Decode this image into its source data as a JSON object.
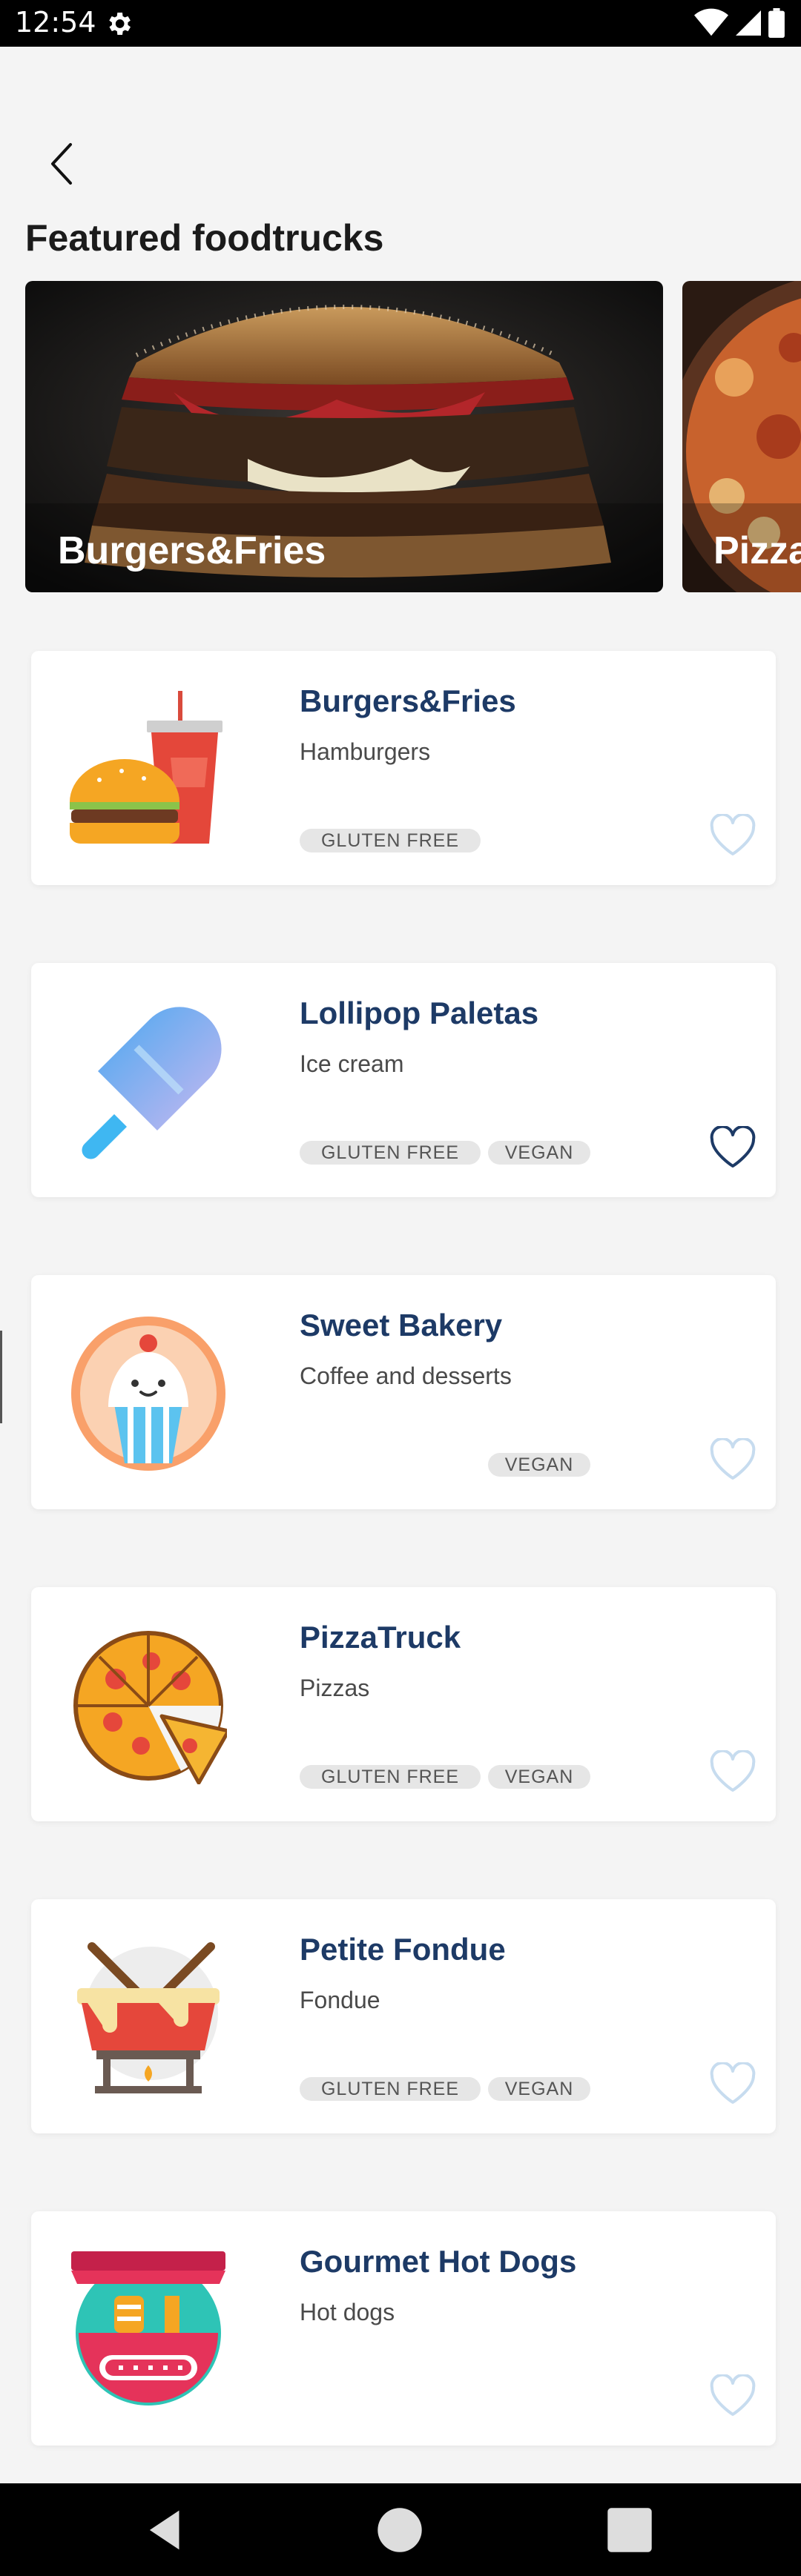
{
  "status_bar": {
    "time": "12:54",
    "icons": [
      "gear-icon",
      "wifi-icon",
      "signal-icon",
      "battery-icon"
    ]
  },
  "header": {
    "back_icon": "chevron-left-icon",
    "title": "Featured foodtrucks"
  },
  "featured": [
    {
      "label": "Burgers&Fries",
      "image": "burger-photo"
    },
    {
      "label": "Pizza",
      "image": "pizza-photo"
    }
  ],
  "trucks": [
    {
      "name": "Burgers&Fries",
      "type": "Hamburgers",
      "icon": "burger-soda-icon",
      "tags": {
        "gluten": "GLUTEN FREE"
      },
      "favorite": false
    },
    {
      "name": "Lollipop Paletas",
      "type": "Ice cream",
      "icon": "popsicle-icon",
      "tags": {
        "gluten": "GLUTEN FREE",
        "vegan": "VEGAN"
      },
      "favorite": true
    },
    {
      "name": "Sweet Bakery",
      "type": "Coffee and desserts",
      "icon": "cupcake-icon",
      "tags": {
        "vegan": "VEGAN"
      },
      "favorite": false
    },
    {
      "name": "PizzaTruck",
      "type": "Pizzas",
      "icon": "pizza-icon",
      "tags": {
        "gluten": "GLUTEN FREE",
        "vegan": "VEGAN"
      },
      "favorite": false
    },
    {
      "name": "Petite Fondue",
      "type": "Fondue",
      "icon": "fondue-icon",
      "tags": {
        "gluten": "GLUTEN FREE",
        "vegan": "VEGAN"
      },
      "favorite": false
    },
    {
      "name": "Gourmet Hot Dogs",
      "type": "Hot dogs",
      "icon": "hotdog-stand-icon",
      "tags": {},
      "favorite": false
    }
  ],
  "colors": {
    "accent": "#1d3a66",
    "heart_inactive": "#c7dcef",
    "heart_active": "#1d3a66",
    "tag_bg": "#e6e6e6"
  },
  "nav_bar": {
    "icons": [
      "nav-back-icon",
      "nav-home-icon",
      "nav-recents-icon"
    ]
  }
}
